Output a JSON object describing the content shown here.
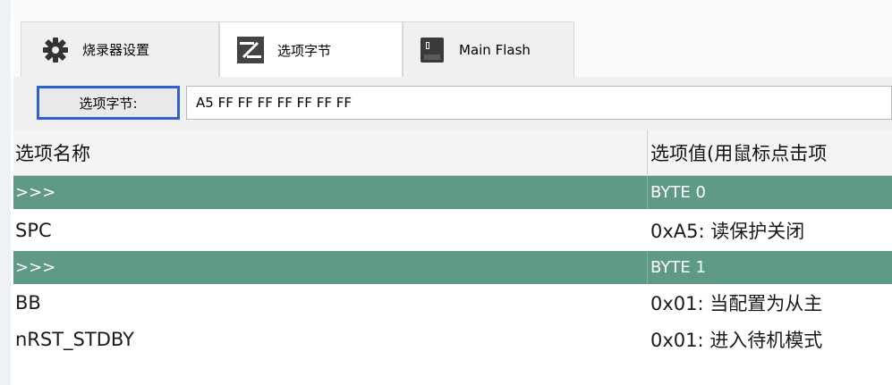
{
  "tabs": [
    {
      "label": "烧录器设置",
      "icon": "gear-icon"
    },
    {
      "label": "选项字节",
      "icon": "option-bytes-icon"
    },
    {
      "label": "Main Flash",
      "icon": "flash-chip-icon"
    }
  ],
  "option_bytes": {
    "button_label": "选项字节:",
    "value": "A5 FF FF FF FF FF FF FF"
  },
  "table": {
    "columns": [
      "选项名称",
      "选项值(用鼠标点击项"
    ],
    "rows": [
      {
        "name": ">>>",
        "value": "BYTE 0",
        "type": "group"
      },
      {
        "name": "SPC",
        "value": "0xA5: 读保护关闭",
        "type": "item"
      },
      {
        "name": ">>>",
        "value": "BYTE 1",
        "type": "group"
      },
      {
        "name": "BB",
        "value": "0x01: 当配置为从主",
        "type": "item"
      },
      {
        "name": "nRST_STDBY",
        "value": "0x01: 进入待机模式",
        "type": "item"
      }
    ]
  },
  "colors": {
    "group_row": "#5f9a86",
    "focus_border": "#2f5fd0"
  }
}
